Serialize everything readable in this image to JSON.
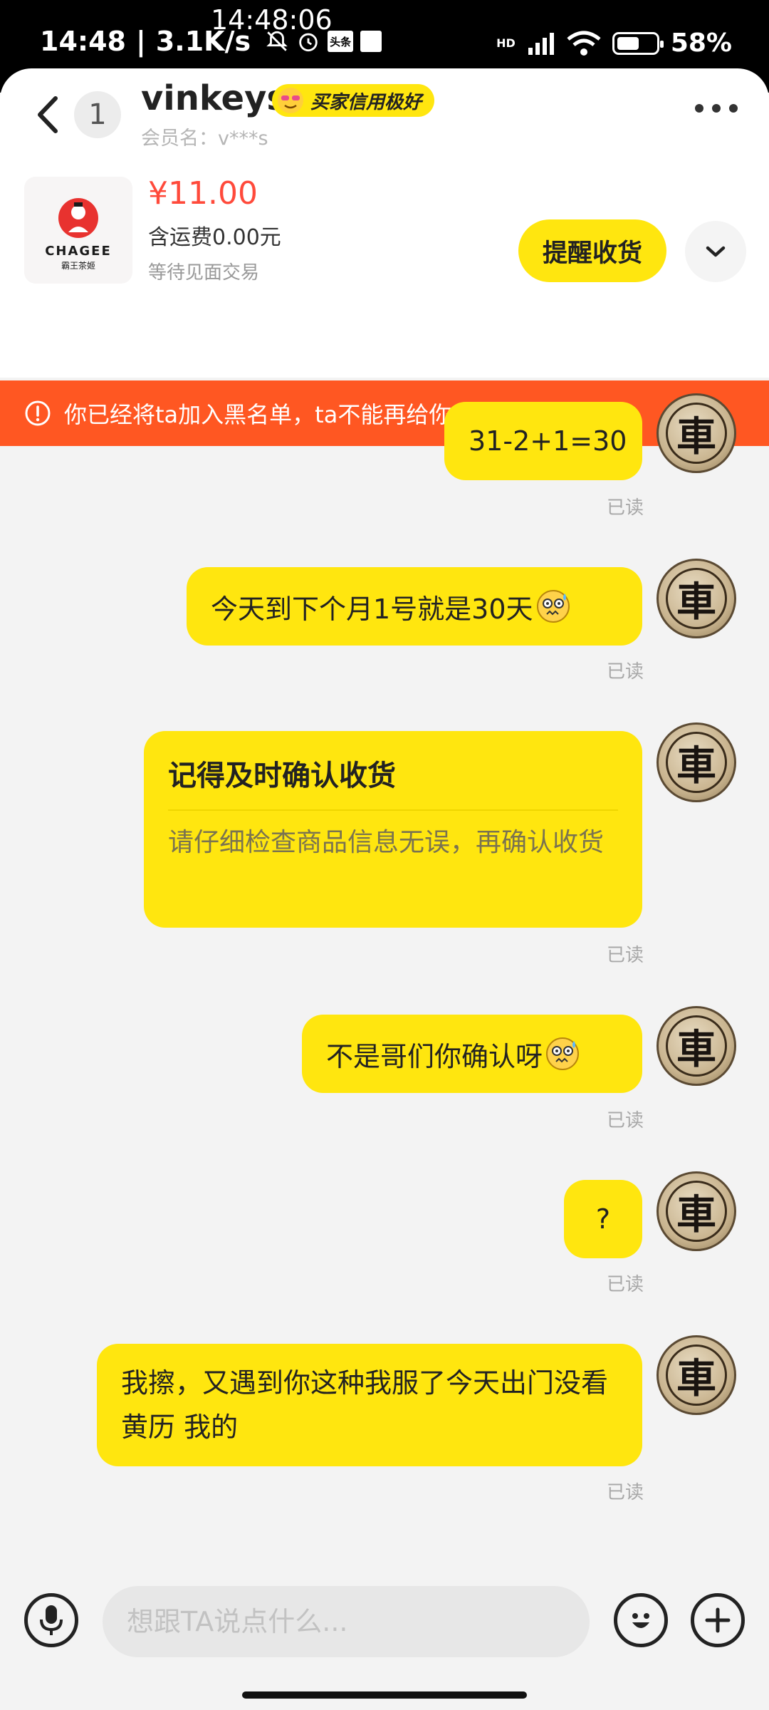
{
  "status_bar": {
    "time": "14:48",
    "speed": "3.1K/s",
    "overlay_time": "14:48:06",
    "hd_label": "HD",
    "battery_percent": "58%",
    "battery_level": 0.58,
    "toutiao_label": "头条"
  },
  "header": {
    "unread_count": "1",
    "name": "vinkeys",
    "credit_badge": "买家信用极好",
    "member": "会员名：v***s"
  },
  "product": {
    "brand": "CHAGEE",
    "brand_cn": "霸王茶姬",
    "price": "¥11.00",
    "shipping": "含运费0.00元",
    "status": "等待见面交易",
    "remind_label": "提醒收货"
  },
  "warning": {
    "text": "你已经将ta加入黑名单，ta不能再给你发送消息"
  },
  "avatar_char": "車",
  "messages": [
    {
      "text": "31-2+1=30",
      "read": "已读"
    },
    {
      "text": "今天到下个月1号就是30天",
      "read": "已读"
    },
    {
      "card_title": "记得及时确认收货",
      "card_body": "请仔细检查商品信息无误，再确认收货",
      "read": "已读"
    },
    {
      "text": "不是哥们你确认呀",
      "read": "已读"
    },
    {
      "text": "?",
      "read": "已读"
    },
    {
      "text": "我擦，又遇到你这种我服了今天出门没看黄历 我的",
      "read": "已读"
    }
  ],
  "input": {
    "placeholder": "想跟TA说点什么..."
  },
  "colors": {
    "accent_yellow": "#ffe60f",
    "warning_orange": "#ff5722",
    "price_red": "#ff4a3b"
  },
  "icons": [
    "back-arrow-icon",
    "more-icon",
    "chevron-down-icon",
    "alert-circle-icon",
    "microphone-icon",
    "emoji-icon",
    "plus-icon"
  ]
}
